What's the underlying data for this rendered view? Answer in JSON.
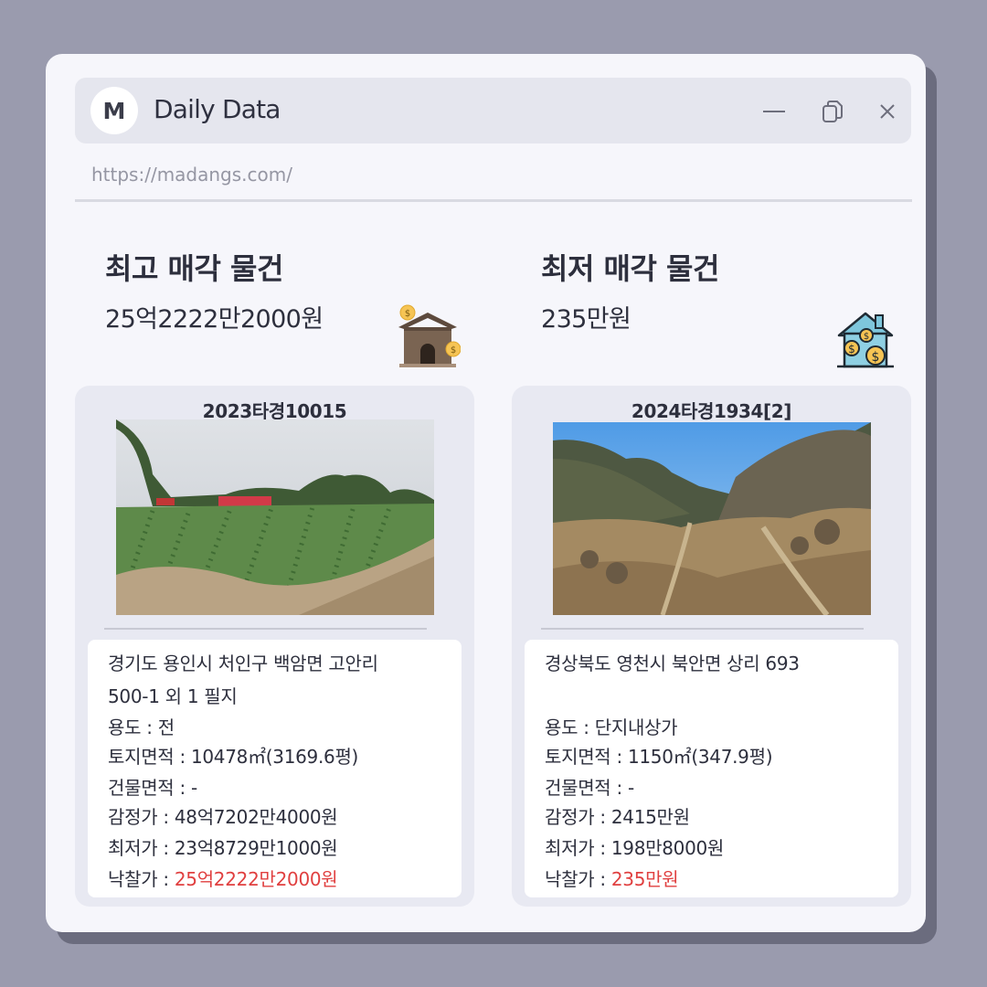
{
  "app": {
    "avatar_letter": "M",
    "title": "Daily Data",
    "url": "https://madangs.com/"
  },
  "window_controls": {
    "minimize_icon": "minimize-icon",
    "restore_icon": "restore-icon",
    "close_icon": "close-icon"
  },
  "highest": {
    "heading": "최고 매각 물건",
    "price": "25억2222만2000원",
    "icon": "house-coins-icon",
    "case_no": "2023타경10015",
    "address_line1": "경기도 용인시 처인구 백암면 고안리",
    "address_line2": "500-1 외 1 필지",
    "usage_label": "용도 : ",
    "usage": "전",
    "land_area": "토지면적 : 10478㎡(3169.6평)",
    "building_area": "건물면적 : -",
    "appraisal": "감정가 : 48억7202만4000원",
    "minimum": "최저가 : 23억8729만1000원",
    "winning_label": "낙찰가 : ",
    "winning": "25억2222만2000원"
  },
  "lowest": {
    "heading": "최저 매각 물건",
    "price": "235만원",
    "icon": "house-money-icon",
    "case_no": "2024타경1934[2]",
    "address_line1": "경상북도 영천시 북안면 상리 693",
    "usage_label": "용도 :  ",
    "usage": "단지내상가",
    "land_area": "토지면적 : 1150㎡(347.9평)",
    "building_area": "건물면적 : -",
    "appraisal": "감정가 : 2415만원",
    "minimum": "최저가 : 198만8000원",
    "winning_label": "낙찰가 : ",
    "winning": "235만원"
  },
  "colors": {
    "background": "#9a9bae",
    "window": "#f6f6fb",
    "accent_price": "#e03f3f"
  }
}
